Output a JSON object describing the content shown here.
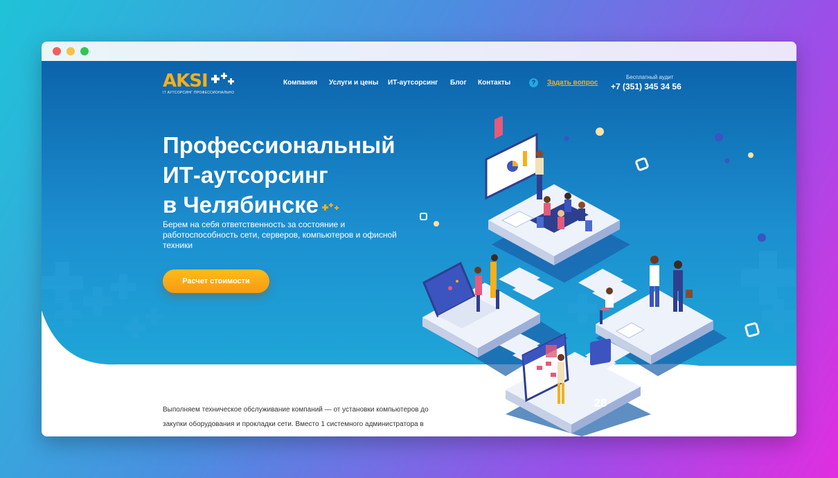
{
  "browser": {
    "dots": [
      "close",
      "minimize",
      "maximize"
    ]
  },
  "logo": {
    "text": "AKSI",
    "subtitle": "IT АУТСОРСИНГ ПРОФЕССИОНАЛЬНО"
  },
  "nav": {
    "items": [
      "Компания",
      "Услуги и цены",
      "ИТ-аутсорсинг",
      "Блог",
      "Контакты"
    ]
  },
  "header": {
    "ask_label": "Задать вопрос",
    "ask_icon": "?",
    "audit_label": "Бесплатный аудит",
    "phone": "+7 (351) 345 34 56"
  },
  "hero": {
    "title_line1": "Профессиональный",
    "title_line2": "ИТ-аутсорсинг",
    "title_line3": "в Челябинске",
    "subtitle": "Берем на себя ответственность за состояние и работоспособность сети, серверов, компьютеров и офисной техники",
    "cta_label": "Расчет стоимости"
  },
  "intro": {
    "text": "Выполняем техническое обслуживание компаний — от установки компьютеров до закупки оборудования и прокладки сети. Вместо 1 системного администратора в"
  },
  "illustration": {
    "calendar_day": "28"
  },
  "colors": {
    "accent": "#f6b01b",
    "hero_top": "#0c63ab",
    "hero_bottom": "#1fa6d8",
    "cta": "#f89a12"
  }
}
